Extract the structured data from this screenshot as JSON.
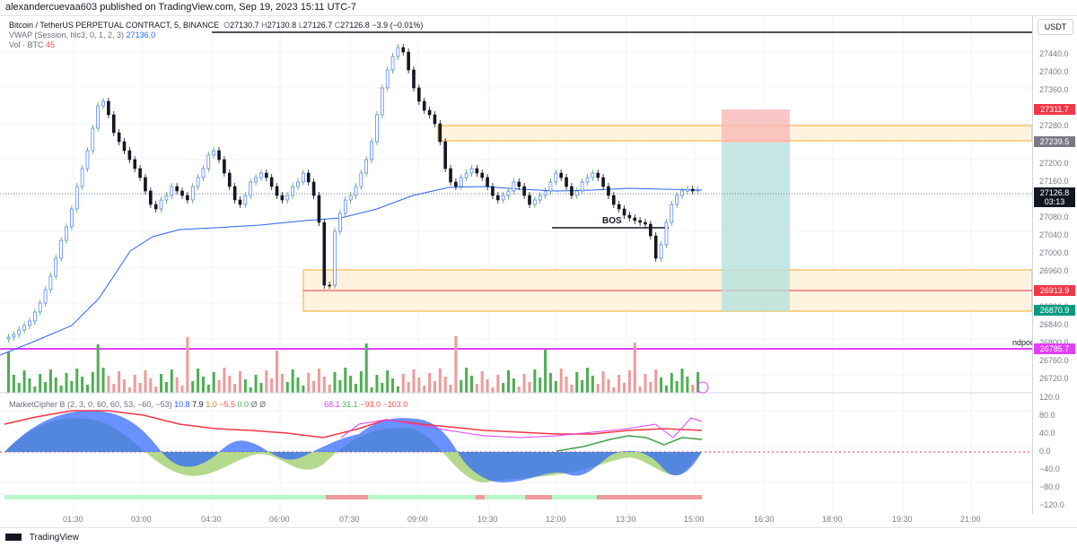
{
  "header": {
    "text": "alexandercuevaa603 published on TradingView.com, Sep 19, 2023 15:11 UTC-7"
  },
  "legend": {
    "symbol": "Bitcoin / TetherUS PERPETUAL CONTRACT, 5, BINANCE",
    "o": "27130.7",
    "h": "27130.8",
    "l": "27126.7",
    "c": "27126.8",
    "change": "−3.9 (−0.01%)",
    "vwap_label": "VWAP (Session, hlc3, 0, 1, 2, 3)",
    "vwap_value": "27136.0",
    "vol_label": "Vol · BTC",
    "vol_value": "45"
  },
  "currency": "USDT",
  "annotations": {
    "bos": "BOS",
    "ndpoc": "ndpoc"
  },
  "price_axis": [
    "27440.0",
    "27400.0",
    "27360.0",
    "27320.0",
    "27280.0",
    "27200.0",
    "27160.0",
    "27120.0",
    "27080.0",
    "27040.0",
    "27000.0",
    "26960.0",
    "26880.0",
    "26840.0",
    "26800.0",
    "26760.0",
    "26720.0"
  ],
  "price_tags": [
    {
      "text": "27311.7",
      "color": "#f23645"
    },
    {
      "text": "27239.5",
      "color": "#787b86"
    },
    {
      "text": "27126.8",
      "color": "#131722"
    },
    {
      "text": "03:13",
      "color": "#131722"
    },
    {
      "text": "26913.9",
      "color": "#f23645"
    },
    {
      "text": "26870.9",
      "color": "#089981"
    },
    {
      "text": "26785.7",
      "color": "#e040fb"
    }
  ],
  "osc_axis": [
    "120.0",
    "80.0",
    "40.0",
    "0.0",
    "−40.0",
    "−80.0",
    "−120.0"
  ],
  "osc_legend": {
    "label": "MarketCipher B (2, 3, 0, 60, 60, 53, −60, −53)",
    "v1": "10.8",
    "v2": "7.9",
    "v3": "1.0",
    "v4": "−5.5",
    "v5": "0.0",
    "v6": "Ø",
    "v7": "Ø",
    "v8": "68.1",
    "v9": "31.1",
    "v10": "−93.0",
    "v11": "−103.0"
  },
  "time_axis": [
    "01:30",
    "03:00",
    "04:30",
    "06:00",
    "07:30",
    "09:00",
    "10:30",
    "12:00",
    "13:30",
    "15:00",
    "16:30",
    "18:00",
    "19:30",
    "21:00"
  ],
  "footer": {
    "brand": "TradingView"
  },
  "colors": {
    "up": "#4caf50",
    "down": "#131722",
    "volup": "#4caf50",
    "voldown": "#ef9a9a",
    "vwap": "#2962ff",
    "zone": "#f9a825",
    "ndpoc": "#e040fb"
  }
}
